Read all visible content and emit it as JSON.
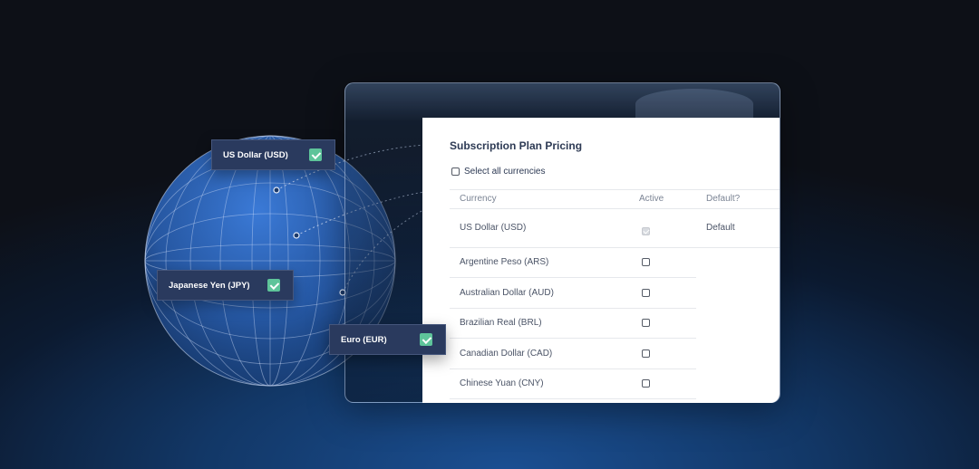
{
  "colors": {
    "background_dark": "#0d1017",
    "background_blue": "#1b4f92",
    "tag_bg": "#2a3a5e",
    "check_green": "#5ec49a",
    "panel_text": "#2d3a54"
  },
  "tags": [
    {
      "label": "US Dollar (USD)",
      "checked": true,
      "icon": "check-icon"
    },
    {
      "label": "Japanese Yen (JPY)",
      "checked": true,
      "icon": "check-icon"
    },
    {
      "label": "Euro (EUR)",
      "checked": true,
      "icon": "check-icon"
    }
  ],
  "panel": {
    "title": "Subscription Plan Pricing",
    "select_all_label": "Select all currencies",
    "columns": {
      "currency": "Currency",
      "active": "Active",
      "default": "Default?"
    },
    "rows": [
      {
        "currency": "US Dollar (USD)",
        "active": true,
        "active_disabled": true,
        "default": "Default"
      },
      {
        "currency": "Argentine Peso (ARS)",
        "active": false,
        "default": ""
      },
      {
        "currency": "Australian Dollar (AUD)",
        "active": false,
        "default": ""
      },
      {
        "currency": "Brazilian Real (BRL)",
        "active": false,
        "default": ""
      },
      {
        "currency": "Canadian Dollar (CAD)",
        "active": false,
        "default": ""
      },
      {
        "currency": "Chinese Yuan (CNY)",
        "active": false,
        "default": ""
      }
    ]
  }
}
